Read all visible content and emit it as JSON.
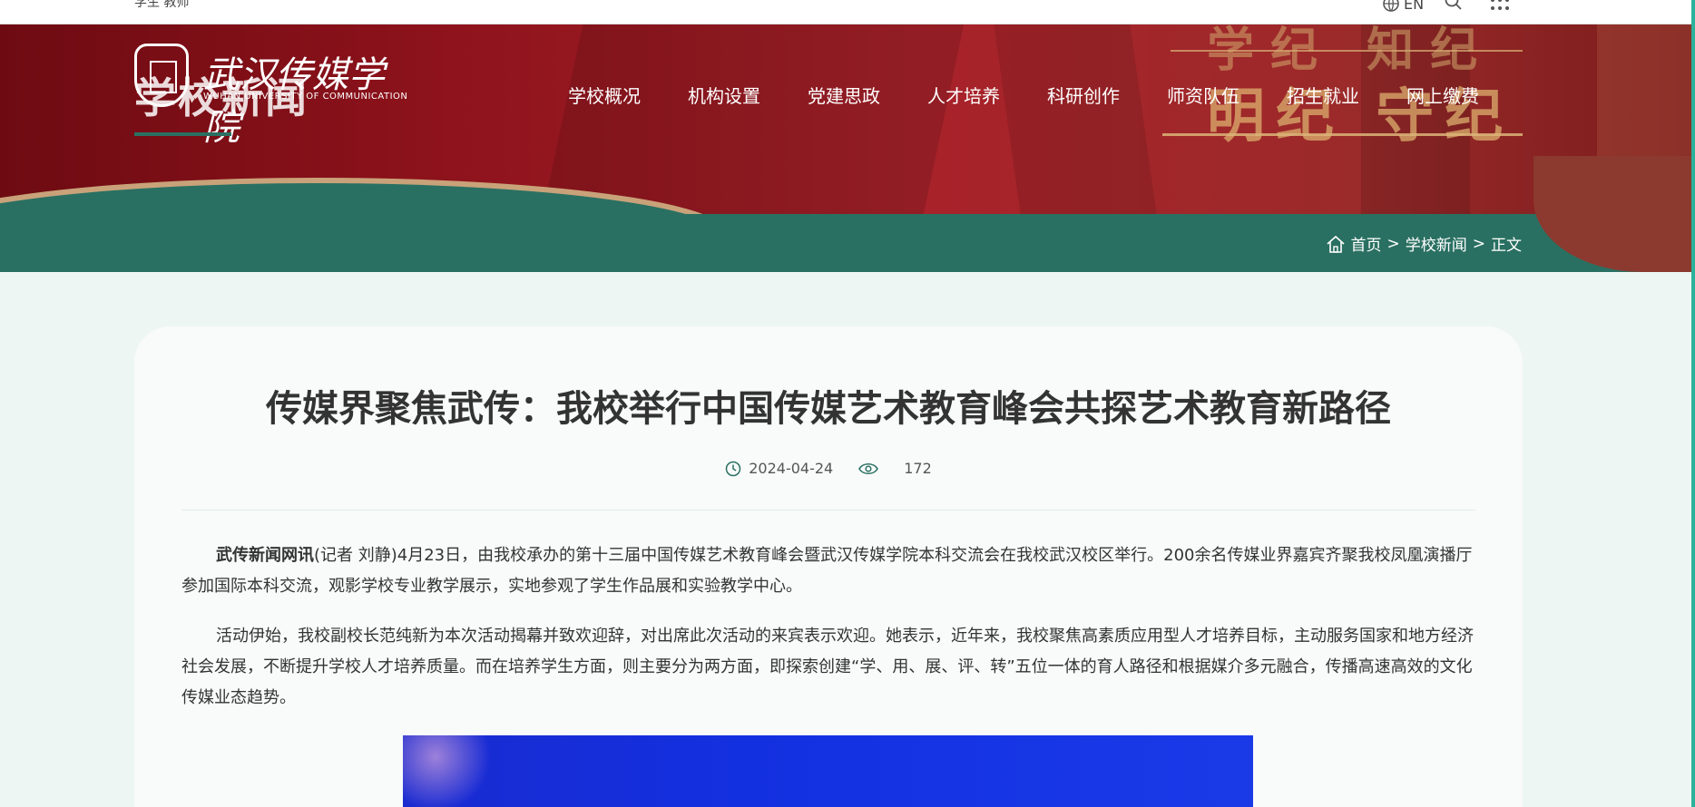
{
  "topbar": {
    "left_text": "学生 教师",
    "lang": "EN"
  },
  "header": {
    "logo_name": "武汉传媒学院",
    "logo_sub": "WUHAN UNIVERSITY OF COMMUNICATION",
    "section_title": "学校新闻",
    "slogan_top": "学纪 知纪",
    "slogan_main": "明纪 守纪",
    "nav": [
      {
        "label": "学校概况"
      },
      {
        "label": "机构设置"
      },
      {
        "label": "党建思政"
      },
      {
        "label": "人才培养"
      },
      {
        "label": "科研创作"
      },
      {
        "label": "师资队伍"
      },
      {
        "label": "招生就业"
      },
      {
        "label": "网上缴费"
      }
    ]
  },
  "breadcrumb": {
    "home": "首页",
    "sep1": ">",
    "section": "学校新闻",
    "sep2": ">",
    "current": "正文"
  },
  "article": {
    "title": "传媒界聚焦武传：我校举行中国传媒艺术教育峰会共探艺术教育新路径",
    "date": "2024-04-24",
    "views": "172",
    "p1_lead": "武传新闻网讯",
    "p1_body": "(记者 刘静)4月23日，由我校承办的第十三届中国传媒艺术教育峰会暨武汉传媒学院本科交流会在我校武汉校区举行。200余名传媒业界嘉宾齐聚我校凤凰演播厅参加国际本科交流，观影学校专业教学展示，实地参观了学生作品展和实验教学中心。",
    "p2": "活动伊始，我校副校长范纯新为本次活动揭幕并致欢迎辞，对出席此次活动的来宾表示欢迎。她表示，近年来，我校聚焦高素质应用型人才培养目标，主动服务国家和地方经济社会发展，不断提升学校人才培养质量。而在培养学生方面，则主要分为两方面，即探索创建“学、用、展、评、转”五位一体的育人路径和根据媒介多元融合，传播高速高效的文化传媒业态趋势。"
  },
  "colors": {
    "header_red": "#8c121b",
    "green": "#2a7062",
    "gold": "#dcaf6e"
  }
}
